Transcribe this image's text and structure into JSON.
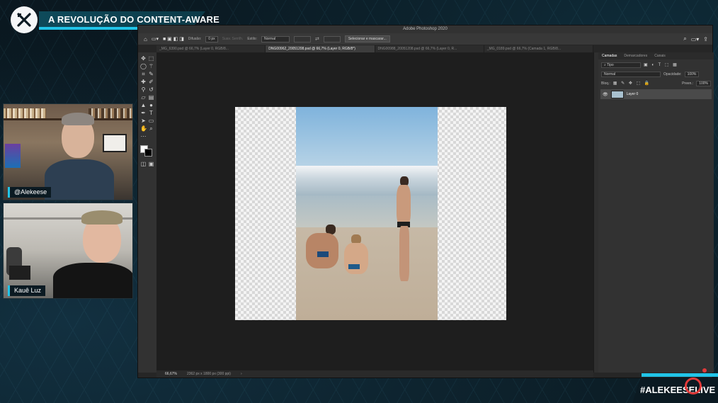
{
  "overlay": {
    "title": "A REVOLUÇÃO DO CONTENT-AWARE",
    "hashtag": "#ALEKEESELIVE",
    "accent_color": "#21c4e8",
    "live_color": "#e03a3a"
  },
  "webcams": [
    {
      "label": "@Alekeese"
    },
    {
      "label": "Kauê Luz"
    }
  ],
  "photoshop": {
    "window_title": "Adobe Photoshop 2020",
    "options_bar": {
      "feather_label": "Difusão:",
      "feather_value": "0 px",
      "antialias_label": "Suav. Serrilh.",
      "style_label": "Estilo:",
      "style_value": "Normal",
      "select_mask_button": "Selecionar e mascarar..."
    },
    "tabs": [
      {
        "label": "_MG_6390.psd @ 66,7% (Layer 0, RGB/8...",
        "active": false
      },
      {
        "label": "DNG00962_20051208.psd @ 66,7% (Layer 0, RGB/8*)",
        "active": true
      },
      {
        "label": "DNG00988_20051208.psd @ 66,7% (Layer 0, R...",
        "active": false
      },
      {
        "label": "_MG_0189.psd @ 66,7% (Camada 1, RGB/8...",
        "active": false
      }
    ],
    "status": {
      "zoom": "66,67%",
      "doc_size": "2362 px x 1800 px (300 ppi)"
    },
    "panel": {
      "tabs": [
        "Camadas",
        "Demarcadores",
        "Canais"
      ],
      "active_tab": "Camadas",
      "filter_label": "Tipo",
      "blend_mode": "Normal",
      "opacity_label": "Opacidade:",
      "opacity_value": "100%",
      "lock_label": "Bloq.:",
      "fill_label": "Preen.:",
      "fill_value": "100%",
      "layers": [
        {
          "name": "Layer 0",
          "visible": true
        }
      ]
    },
    "tools": [
      "move-icon",
      "artboard-icon",
      "lasso-icon",
      "magic-wand-icon",
      "crop-icon",
      "eyedropper-icon",
      "healing-icon",
      "brush-icon",
      "stamp-icon",
      "history-brush-icon",
      "eraser-icon",
      "gradient-icon",
      "blur-icon",
      "dodge-icon",
      "pen-icon",
      "type-icon",
      "path-select-icon",
      "rectangle-icon",
      "hand-icon",
      "zoom-icon",
      "more-icon",
      "foreground-color-icon"
    ]
  }
}
